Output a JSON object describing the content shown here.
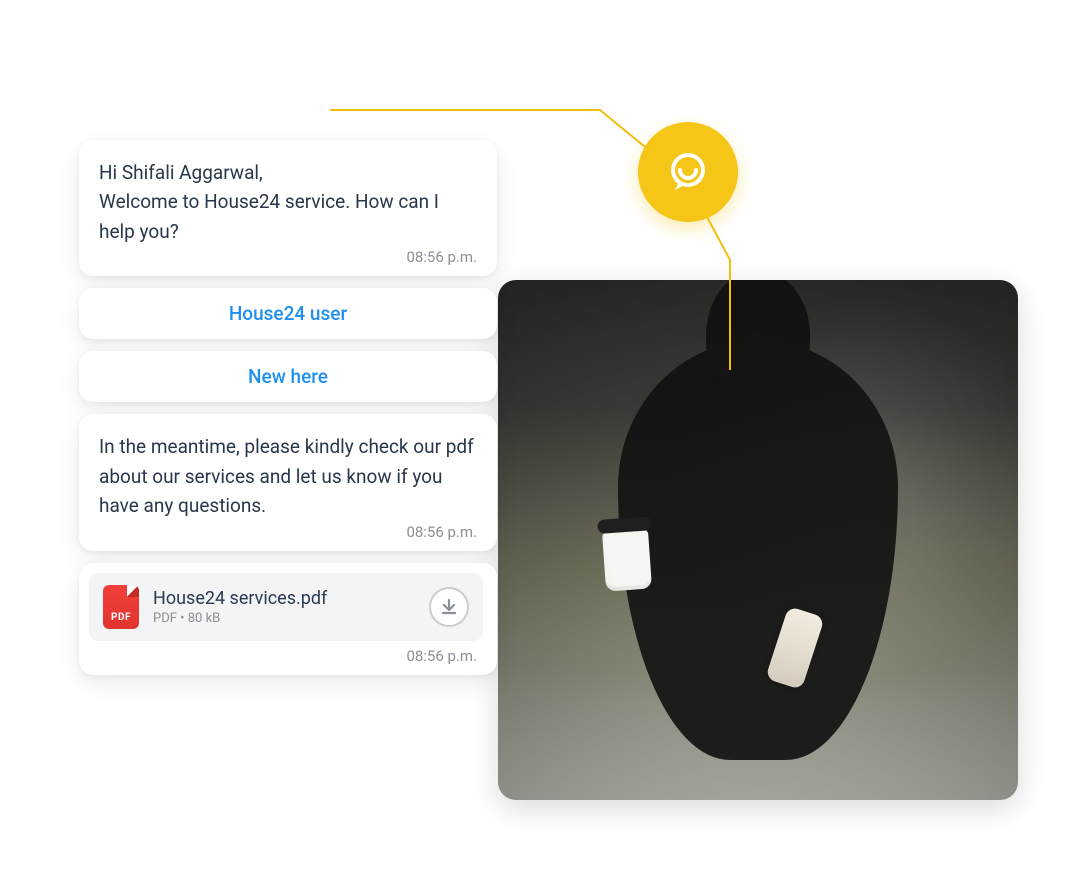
{
  "colors": {
    "accent_yellow": "#f5c518",
    "link_blue": "#1f8ff2",
    "text_dark": "#29374a",
    "muted": "#8a8f98",
    "pdf_red": "#e0342f"
  },
  "chat": {
    "messages": [
      {
        "text": "Hi Shifali Aggarwal,\nWelcome to House24 service. How can I help you?",
        "time": "08:56 p.m."
      },
      {
        "text": "In the meantime, please kindly check our pdf about our services and let us know if you have any questions.",
        "time": "08:56 p.m."
      }
    ],
    "options": [
      {
        "label": "House24 user"
      },
      {
        "label": "New here"
      }
    ],
    "attachment": {
      "icon_label": "PDF",
      "filename": "House24 services.pdf",
      "meta": "PDF • 80 kB",
      "time": "08:56 p.m."
    }
  }
}
